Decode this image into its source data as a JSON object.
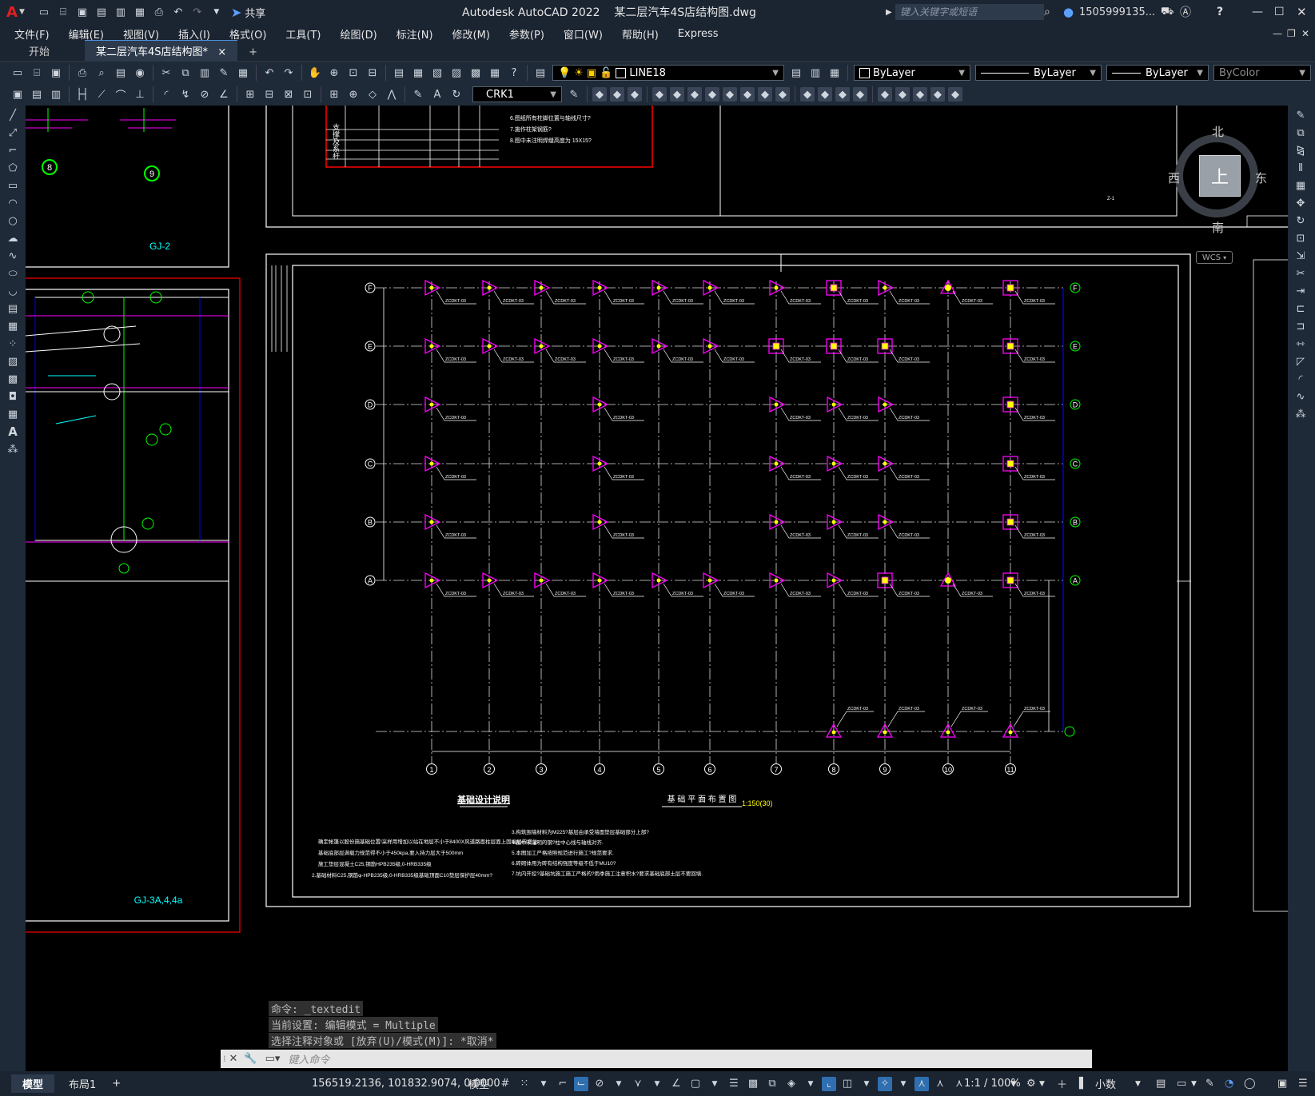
{
  "titlebar": {
    "app_icon": "A",
    "share_label": "共享",
    "window_title": "Autodesk AutoCAD 2022    某二层汽车4S店结构图.dwg",
    "search_placeholder": "键入关键字或短语",
    "user": "1505999135...",
    "help": "?"
  },
  "menu": [
    "文件(F)",
    "编辑(E)",
    "视图(V)",
    "插入(I)",
    "格式(O)",
    "工具(T)",
    "绘图(D)",
    "标注(N)",
    "修改(M)",
    "参数(P)",
    "窗口(W)",
    "帮助(H)",
    "Express"
  ],
  "tabs": {
    "start": "开始",
    "drawing": "某二层汽车4S店结构图*",
    "close": "×",
    "add": "+"
  },
  "toolbar": {
    "layer_name": "LINE18",
    "color": "ByLayer",
    "linetype": "ByLayer",
    "lineweight": "ByLayer",
    "plotstyle": "ByColor",
    "dimstyle": "CRK1"
  },
  "viewcube": {
    "north": "北",
    "south": "南",
    "east": "东",
    "west": "西",
    "top": "上",
    "wcs": "WCS"
  },
  "drawing": {
    "frame_labels": {
      "gj2": "GJ-2",
      "gj3": "GJ-3A,4,4a",
      "z1": "Z-1"
    },
    "grid_rows": [
      "F",
      "E",
      "D",
      "C",
      "B",
      "A"
    ],
    "grid_cols": [
      "1",
      "2",
      "3",
      "4",
      "5",
      "6",
      "7",
      "8",
      "9",
      "10",
      "11"
    ],
    "zj_label": "ZCDKT-03",
    "note_title": "基础设计说明",
    "plan_title": "基 础 平 面 布 置 图",
    "plan_scale": "1:150(30)",
    "balloon_8": "8",
    "balloon_9": "9",
    "table_support": "支撑及系杆",
    "notes_left": [
      "确定帐篷以股份施基础位置!采样用增加以站在地层不小于8400X风道路面柱层面上固端层的增益",
      "基础底部层满载力规范得不小于450kpa,要入持力层大于500mm",
      "施工垫层混凝土C25,钢筋HPB235级,0-HRB335级",
      "2.基础材料C25,钢筋φ-HPB235级,0-HRB335级基础顶面C10垫层保护层40mm?"
    ],
    "notes_right": [
      "3.构筑围墙材料为M225?基层由承受墙面垫层基础部分上部?",
      "4.图中未注明的钢?柱中心线与轴线对齐.",
      "5.本图加工严格按照规范进行施工?规范要求.",
      "6.砖砌体用为砖有结构强度等级不低于MU10?",
      "7.坑内开挖?基础坑施工施工严格的?雨季施工注意积水?要求基础底部土层不要回填."
    ],
    "top_notes": [
      "6.图纸所有柱脚位置与轴线尺寸?",
      "7.施作柱架钢筋?",
      "8.图中未注明焊缝高度为 15X15?"
    ]
  },
  "command": {
    "history": [
      "命令: _textedit",
      "当前设置: 编辑模式 = Multiple",
      "选择注释对象或 [放弃(U)/模式(M)]: *取消*"
    ],
    "placeholder": "键入命令"
  },
  "status": {
    "tab_model": "模型",
    "tab_layout1": "布局1",
    "add": "+",
    "coords": "156519.2136, 101832.9074, 0.0000",
    "space": "模型",
    "scale": "1:1 / 100%",
    "units": "小数"
  },
  "colors": {
    "grid": "#ffffff",
    "axis": "#ffffff",
    "column": "#ff00ff",
    "column_fill": "#ffff00",
    "red_frame": "#ff0000",
    "green": "#00ff00",
    "cyan": "#00ffff",
    "blue": "#0000ff"
  }
}
